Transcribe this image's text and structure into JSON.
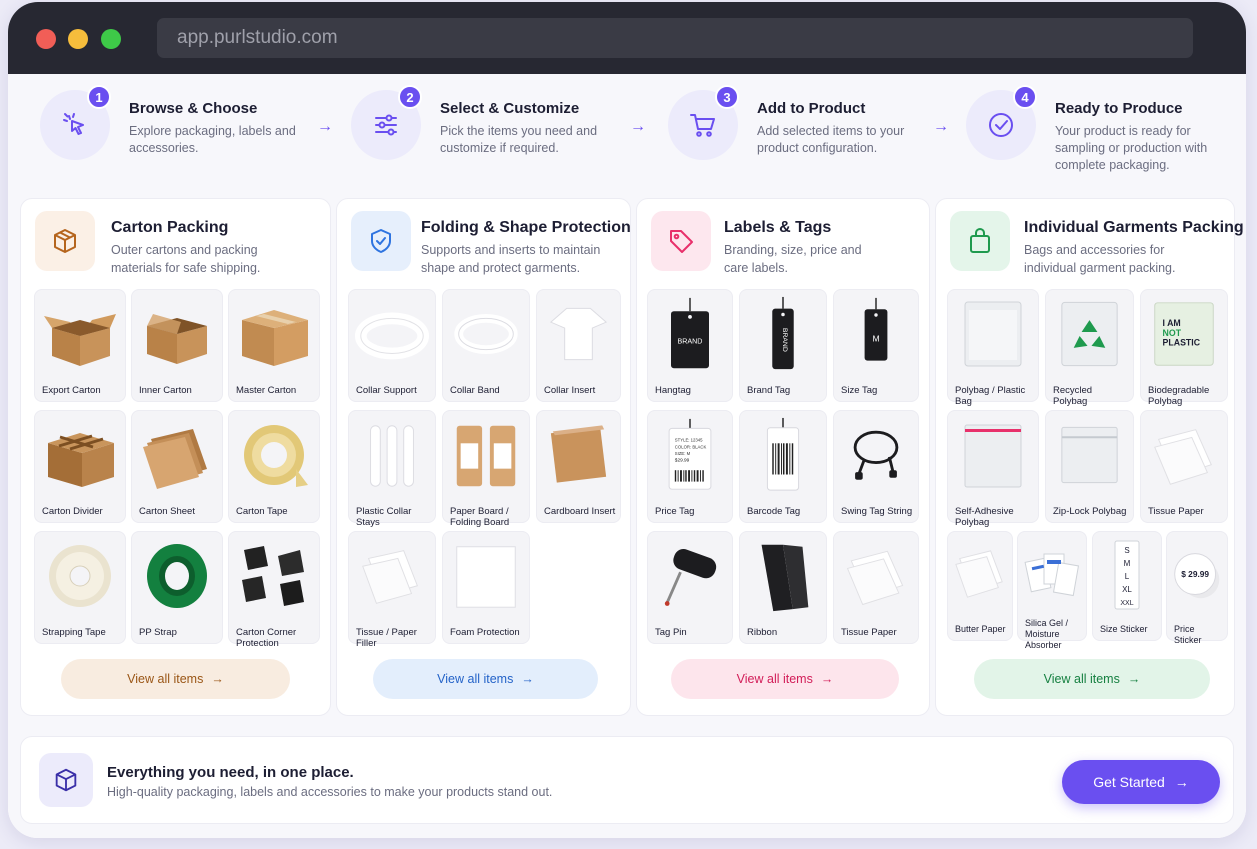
{
  "browser": {
    "url": "app.purlstudio.com"
  },
  "steps": [
    {
      "num": "1",
      "title": "Browse & Choose",
      "desc": "Explore packaging, labels and accessories.",
      "icon": "cursor-click-icon"
    },
    {
      "num": "2",
      "title": "Select & Customize",
      "desc": "Pick the items you need and customize if required.",
      "icon": "sliders-icon"
    },
    {
      "num": "3",
      "title": "Add to Product",
      "desc": "Add selected items to your product configuration.",
      "icon": "shopping-cart-icon"
    },
    {
      "num": "4",
      "title": "Ready to Produce",
      "desc": "Your product is ready for sampling or production with complete packaging.",
      "icon": "check-circle-icon"
    }
  ],
  "categories": [
    {
      "title": "Carton Packing",
      "desc": "Outer cartons and packing materials for safe shipping.",
      "icon": "box-icon",
      "accent": "#b5651d",
      "icon_bg": "#fbf0e6",
      "btn_bg": "#f8ece0",
      "btn_color": "#9a5616",
      "items": [
        "Export Carton",
        "Inner Carton",
        "Master Carton",
        "Carton Divider",
        "Carton Sheet",
        "Carton Tape",
        "Strapping Tape",
        "PP Strap",
        "Carton Corner Protection"
      ],
      "view_label": "View all items"
    },
    {
      "title": "Folding & Shape Protection",
      "desc": "Supports and inserts to maintain shape and protect garments.",
      "icon": "shield-icon",
      "accent": "#2f74e0",
      "icon_bg": "#e6effc",
      "btn_bg": "#e3eefc",
      "btn_color": "#2463c8",
      "items": [
        "Collar Support",
        "Collar Band",
        "Collar Insert",
        "Plastic Collar Stays",
        "Paper Board / Folding Board",
        "Cardboard Insert",
        "Tissue / Paper Filler",
        "Foam Protection"
      ],
      "view_label": "View all items"
    },
    {
      "title": "Labels & Tags",
      "desc": "Branding, size, price and care labels.",
      "icon": "tag-icon",
      "accent": "#e8306b",
      "icon_bg": "#fde7ee",
      "btn_bg": "#fde5ec",
      "btn_color": "#d21d58",
      "items": [
        "Hangtag",
        "Brand Tag",
        "Size Tag",
        "Price Tag",
        "Barcode Tag",
        "Swing Tag String",
        "Tag Pin",
        "Ribbon",
        "Tissue Paper"
      ],
      "tag_texts": {
        "brand": "BRAND",
        "size": "M",
        "price_lines": [
          "STYLE: 12345",
          "COLOR: BLACK",
          "SIZE: M",
          "$29.99"
        ]
      },
      "view_label": "View all items"
    },
    {
      "title": "Individual Garments Packing",
      "desc": "Bags and accessories for individual garment packing.",
      "icon": "shopping-bag-icon",
      "accent": "#1f9a4e",
      "icon_bg": "#e4f5ea",
      "btn_bg": "#e2f4e8",
      "btn_color": "#168041",
      "items": [
        "Polybag / Plastic Bag",
        "Recycled Polybag",
        "Biodegradable Polybag",
        "Self-Adhesive Polybag",
        "Zip-Lock Polybag",
        "Tissue Paper",
        "Butter Paper",
        "Silica Gel / Moisture Absorber",
        "Size Sticker",
        "Price Sticker"
      ],
      "bag_text": [
        "I AM",
        "NOT",
        "PLASTIC"
      ],
      "size_sticker_text": [
        "S",
        "M",
        "L",
        "XL",
        "XXL"
      ],
      "price_sticker_text": "$ 29.99",
      "view_label": "View all items"
    }
  ],
  "footer": {
    "title": "Everything you need, in one place.",
    "subtitle": "High-quality packaging, labels and accessories to make your products stand out.",
    "cta": "Get Started"
  }
}
